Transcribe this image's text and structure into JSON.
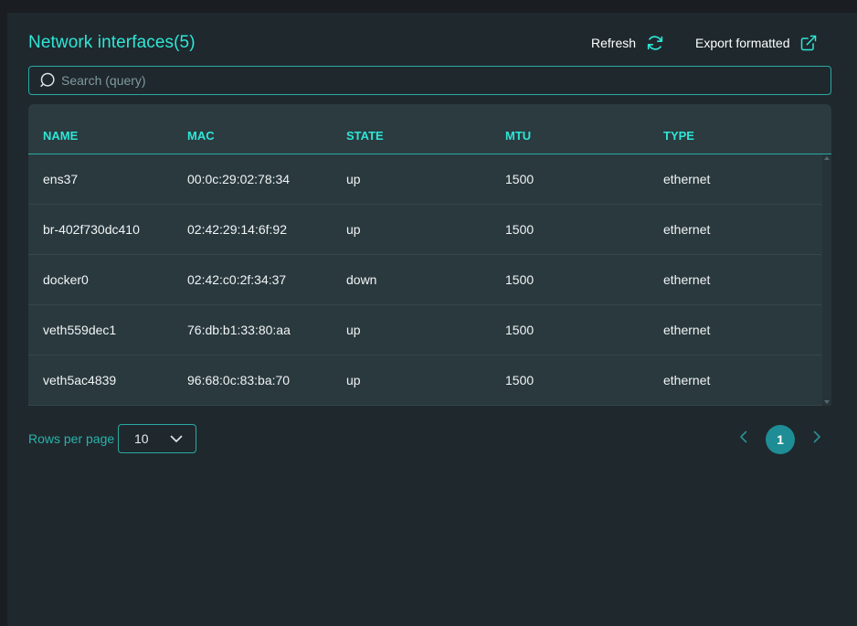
{
  "header": {
    "title": "Network interfaces(5)",
    "refresh_label": "Refresh",
    "export_label": "Export formatted"
  },
  "search": {
    "placeholder": "Search (query)",
    "value": ""
  },
  "table": {
    "columns": [
      "NAME",
      "MAC",
      "STATE",
      "MTU",
      "TYPE"
    ],
    "rows": [
      [
        "ens37",
        "00:0c:29:02:78:34",
        "up",
        "1500",
        "ethernet"
      ],
      [
        "br-402f730dc410",
        "02:42:29:14:6f:92",
        "up",
        "1500",
        "ethernet"
      ],
      [
        "docker0",
        "02:42:c0:2f:34:37",
        "down",
        "1500",
        "ethernet"
      ],
      [
        "veth559dec1",
        "76:db:b1:33:80:aa",
        "up",
        "1500",
        "ethernet"
      ],
      [
        "veth5ac4839",
        "96:68:0c:83:ba:70",
        "up",
        "1500",
        "ethernet"
      ]
    ]
  },
  "pagination": {
    "rows_per_page_label": "Rows per page",
    "rows_per_page_value": "10",
    "current_page": "1"
  },
  "icons": {
    "search": "search-icon",
    "refresh": "refresh-icon",
    "export": "external-link-icon",
    "dropdown": "chevron-down-icon",
    "prev": "chevron-left-icon",
    "next": "chevron-right-icon"
  },
  "colors": {
    "accent": "#2ee6d6",
    "border": "#2aa9a3",
    "page_active": "#1e8d95",
    "background": "#1f282d",
    "table_bg": "#29393e"
  }
}
